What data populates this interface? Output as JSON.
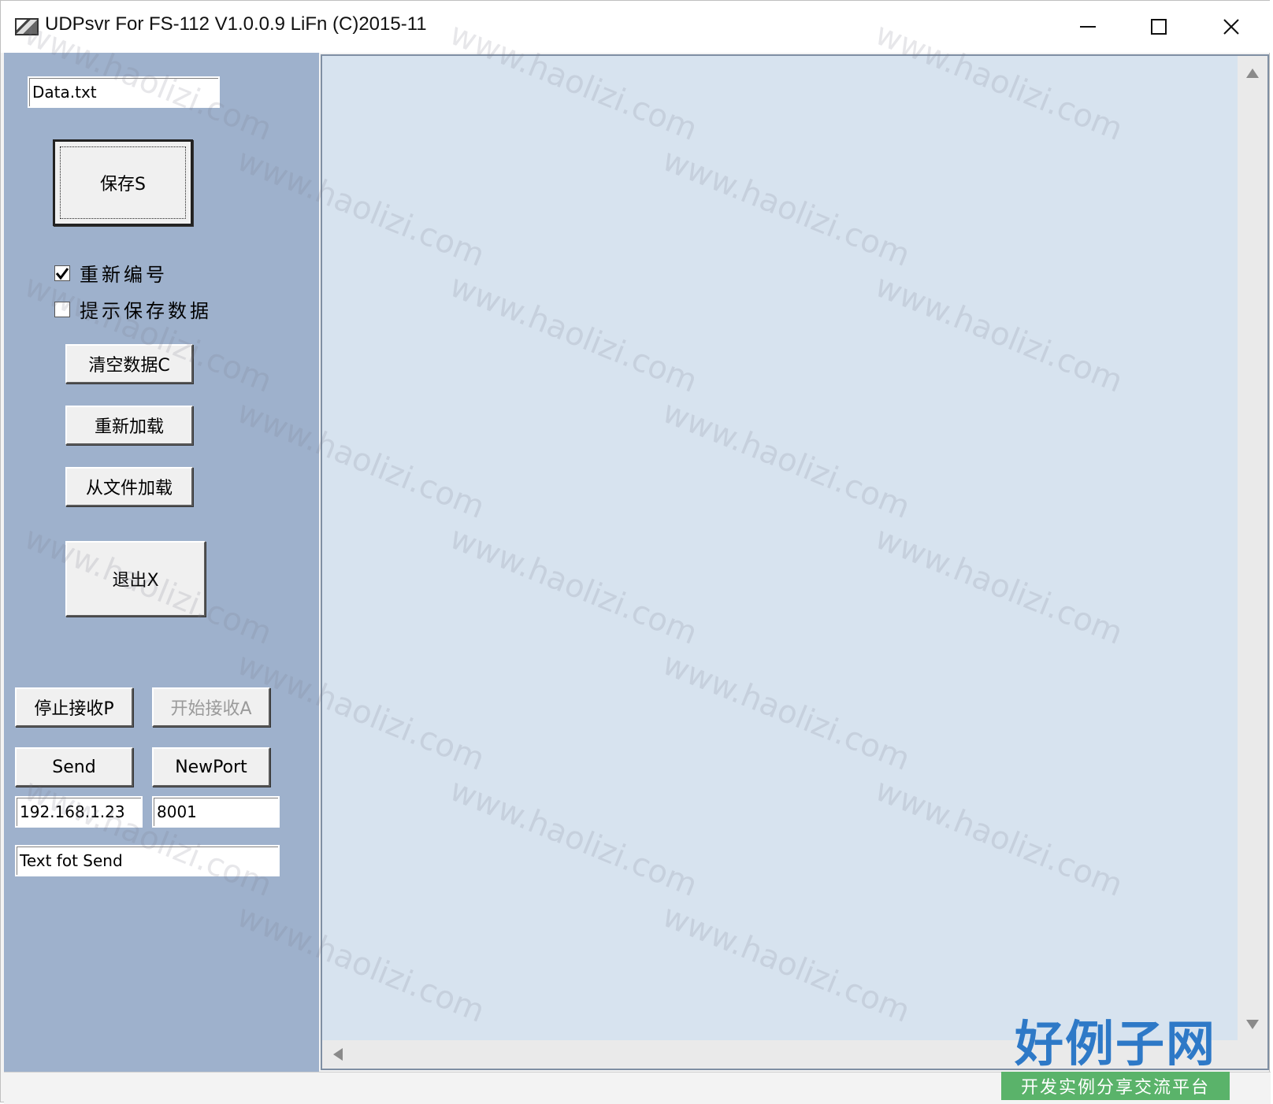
{
  "window": {
    "title": "UDPsvr For FS-112 V1.0.0.9 LiFn (C)2015-11"
  },
  "icons": {
    "minimize": "minimize-icon",
    "maximize": "maximize-icon",
    "close": "close-icon"
  },
  "panel": {
    "filename_value": "Data.txt",
    "save_label": "保存S",
    "renumber_label": "重新编号",
    "renumber_checked": true,
    "prompt_save_label": "提示保存数据",
    "prompt_save_checked": false,
    "clear_label": "清空数据C",
    "reload_label": "重新加载",
    "load_file_label": "从文件加载",
    "exit_label": "退出X",
    "stop_recv_label": "停止接收P",
    "start_recv_label": "开始接收A",
    "send_label": "Send",
    "newport_label": "NewPort",
    "ip_value": "192.168.1.23",
    "port_value": "8001",
    "send_text_value": "Text fot Send"
  },
  "watermark": {
    "text": "www.haolizi.com",
    "brand_main": "好例子网",
    "brand_sub": "开发实例分享交流平台"
  },
  "colors": {
    "panel_bg": "#9eb1cc",
    "list_bg": "#d7e3ef",
    "brand_blue": "#2e79c7",
    "brand_green": "#5ab36a"
  }
}
